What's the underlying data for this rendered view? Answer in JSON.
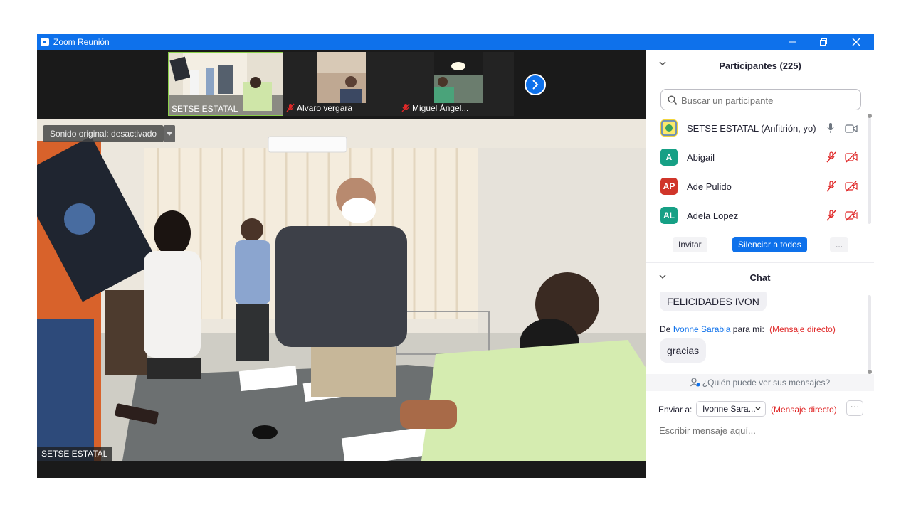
{
  "window": {
    "title": "Zoom Reunión",
    "accent": "#0e71eb"
  },
  "thumbnails": [
    {
      "name": "SETSE ESTATAL",
      "muted": false
    },
    {
      "name": "Alvaro vergara",
      "muted": true
    },
    {
      "name": "Miguel Ángel...",
      "muted": true
    }
  ],
  "main_video": {
    "sound_label": "Sonido original: desactivado",
    "speaker_name": "SETSE ESTATAL"
  },
  "participants": {
    "title": "Participantes (225)",
    "search_placeholder": "Buscar un participante",
    "list": [
      {
        "initials": "",
        "name": "SETSE ESTATAL (Anfitrión, yo)",
        "color": "#f2d53c",
        "mic": "on",
        "video": "on"
      },
      {
        "initials": "A",
        "name": "Abigail",
        "color": "#16a085",
        "mic": "muted",
        "video": "off"
      },
      {
        "initials": "AP",
        "name": "Ade Pulido",
        "color": "#d0352a",
        "mic": "muted",
        "video": "off"
      },
      {
        "initials": "AL",
        "name": "Adela Lopez",
        "color": "#16a085",
        "mic": "muted",
        "video": "off"
      }
    ],
    "invite_label": "Invitar",
    "mute_all_label": "Silenciar a todos",
    "more_label": "..."
  },
  "chat": {
    "title": "Chat",
    "messages": {
      "m1": "FELICIDADES IVON",
      "from_prefix": "De",
      "from_name": "Ivonne Sarabia",
      "from_suffix": "para mí:",
      "direct_tag": "(Mensaje directo)",
      "m2": "gracias"
    },
    "who_can_see": "¿Quién puede ver sus mensajes?",
    "send_to_label": "Enviar a:",
    "send_to_value": "Ivonne Sara...",
    "send_to_tag": "(Mensaje directo)",
    "more_label": "···",
    "input_placeholder": "Escribir mensaje aquí..."
  }
}
